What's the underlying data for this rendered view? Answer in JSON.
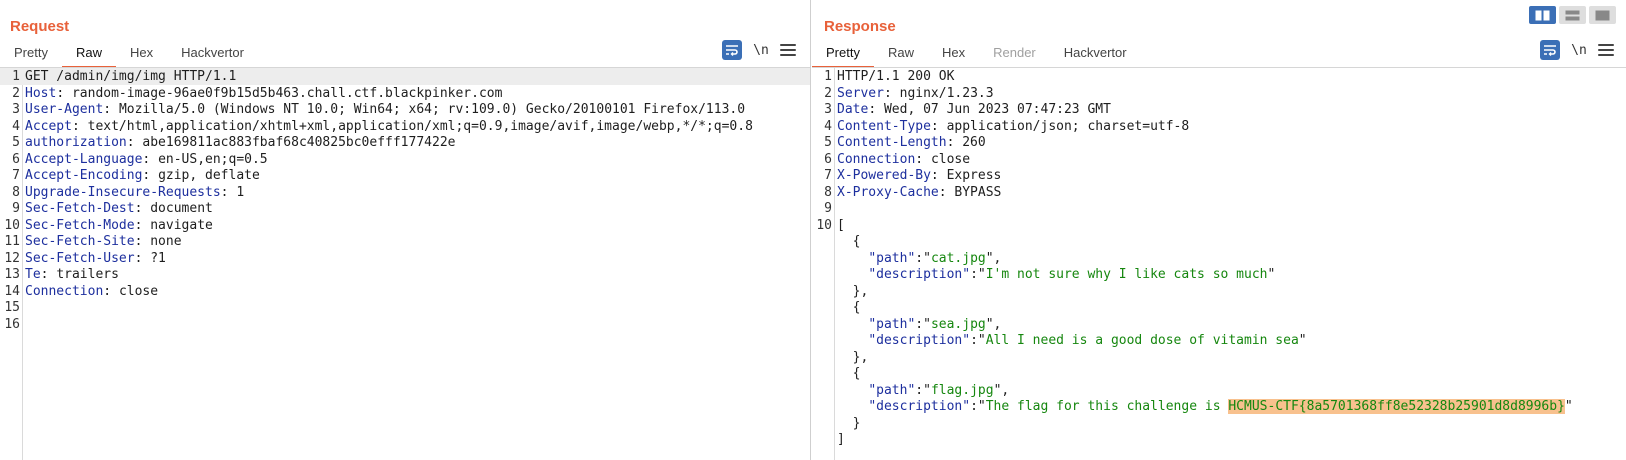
{
  "request": {
    "title": "Request",
    "tabs": [
      {
        "label": "Pretty",
        "state": "normal"
      },
      {
        "label": "Raw",
        "state": "active"
      },
      {
        "label": "Hex",
        "state": "normal"
      },
      {
        "label": "Hackvertor",
        "state": "normal"
      }
    ],
    "newline_label": "\\n",
    "lines": [
      {
        "num": "1",
        "key": "",
        "text": "GET /admin/img/img HTTP/1.1"
      },
      {
        "num": "2",
        "key": "Host",
        "text": "random-image-96ae0f9b15d5b463.chall.ctf.blackpinker.com"
      },
      {
        "num": "3",
        "key": "User-Agent",
        "text": "Mozilla/5.0 (Windows NT 10.0; Win64; x64; rv:109.0) Gecko/20100101 Firefox/113.0"
      },
      {
        "num": "4",
        "key": "Accept",
        "text": "text/html,application/xhtml+xml,application/xml;q=0.9,image/avif,image/webp,*/*;q=0.8"
      },
      {
        "num": "5",
        "key": "authorization",
        "text": "abe169811ac883fbaf68c40825bc0efff177422e"
      },
      {
        "num": "6",
        "key": "Accept-Language",
        "text": "en-US,en;q=0.5"
      },
      {
        "num": "7",
        "key": "Accept-Encoding",
        "text": "gzip, deflate"
      },
      {
        "num": "8",
        "key": "Upgrade-Insecure-Requests",
        "text": "1"
      },
      {
        "num": "9",
        "key": "Sec-Fetch-Dest",
        "text": "document"
      },
      {
        "num": "10",
        "key": "Sec-Fetch-Mode",
        "text": "navigate"
      },
      {
        "num": "11",
        "key": "Sec-Fetch-Site",
        "text": "none"
      },
      {
        "num": "12",
        "key": "Sec-Fetch-User",
        "text": "?1"
      },
      {
        "num": "13",
        "key": "Te",
        "text": "trailers"
      },
      {
        "num": "14",
        "key": "Connection",
        "text": "close"
      },
      {
        "num": "15",
        "key": "",
        "text": ""
      },
      {
        "num": "16",
        "key": "",
        "text": ""
      }
    ]
  },
  "response": {
    "title": "Response",
    "tabs": [
      {
        "label": "Pretty",
        "state": "active"
      },
      {
        "label": "Raw",
        "state": "normal"
      },
      {
        "label": "Hex",
        "state": "normal"
      },
      {
        "label": "Render",
        "state": "disabled"
      },
      {
        "label": "Hackvertor",
        "state": "normal"
      }
    ],
    "newline_label": "\\n",
    "headers": [
      {
        "num": "1",
        "key": "",
        "text": "HTTP/1.1 200 OK"
      },
      {
        "num": "2",
        "key": "Server",
        "text": "nginx/1.23.3"
      },
      {
        "num": "3",
        "key": "Date",
        "text": "Wed, 07 Jun 2023 07:47:23 GMT"
      },
      {
        "num": "4",
        "key": "Content-Type",
        "text": "application/json; charset=utf-8"
      },
      {
        "num": "5",
        "key": "Content-Length",
        "text": "260"
      },
      {
        "num": "6",
        "key": "Connection",
        "text": "close"
      },
      {
        "num": "7",
        "key": "X-Powered-By",
        "text": "Express"
      },
      {
        "num": "8",
        "key": "X-Proxy-Cache",
        "text": "BYPASS"
      },
      {
        "num": "9",
        "key": "",
        "text": ""
      }
    ],
    "body_line_num": "10",
    "items": [
      {
        "path": "cat.jpg",
        "description": "I'm not sure why I like cats so much"
      },
      {
        "path": "sea.jpg",
        "description": "All I need is a good dose of vitamin sea"
      },
      {
        "path": "flag.jpg",
        "description_prefix": "The flag for this challenge is ",
        "flag": "HCMUS-CTF{8a5701368ff8e52328b25901d8d8996b}"
      }
    ]
  }
}
